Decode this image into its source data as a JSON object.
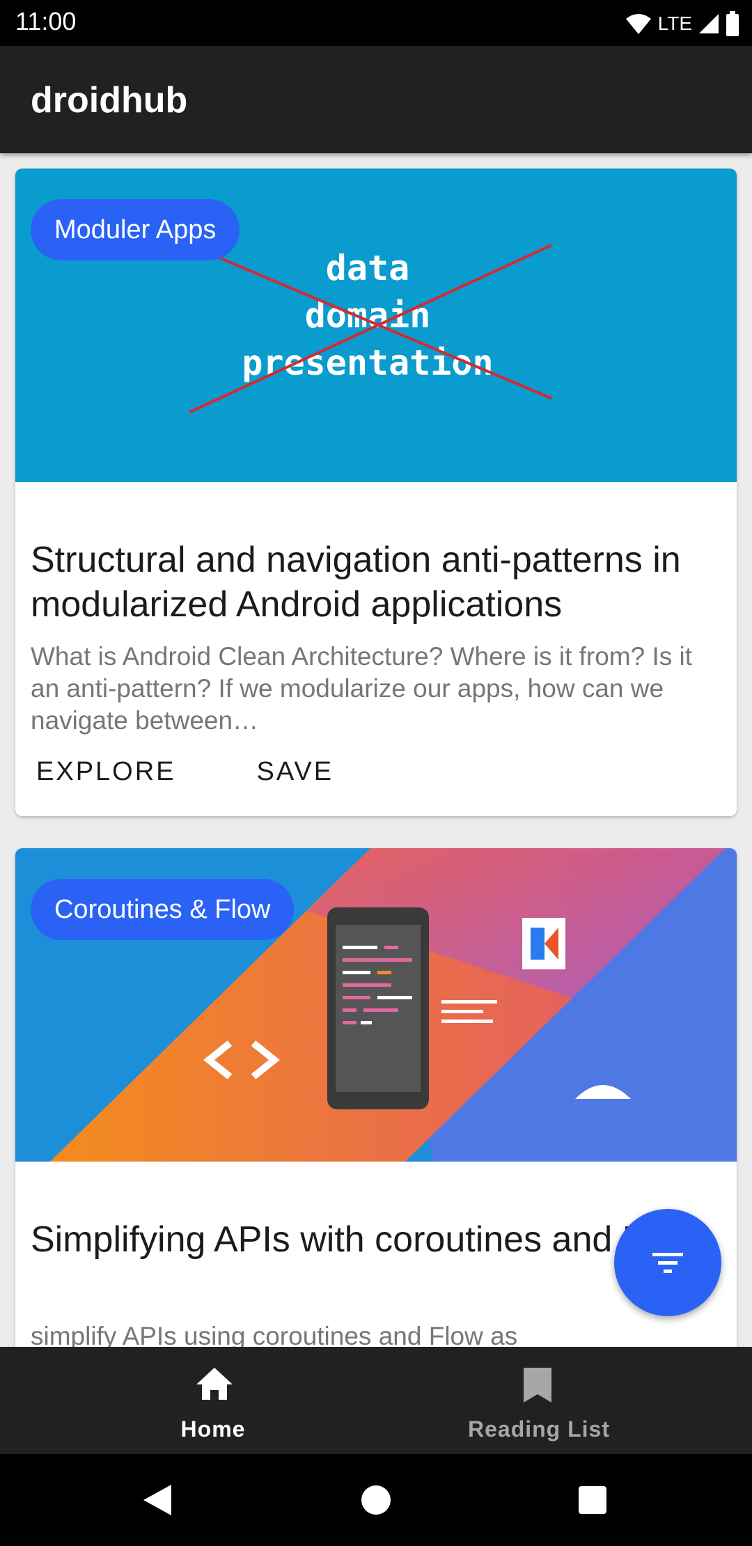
{
  "status_bar": {
    "time": "11:00",
    "network": "LTE"
  },
  "app_bar": {
    "title": "droidhub"
  },
  "cards": [
    {
      "chip": "Moduler Apps",
      "banner_words": [
        "data",
        "domain",
        "presentation"
      ],
      "title": "Structural and navigation anti-patterns in modularized Android applications",
      "description": "What is Android Clean Architecture? Where is it from? Is it an anti-pattern? If we modularize our apps, how can we navigate between…",
      "actions": [
        "EXPLORE",
        "SAVE"
      ]
    },
    {
      "chip": "Coroutines & Flow",
      "title": "Simplifying APIs with coroutines and Flow",
      "description": "simplify APIs using coroutines and Flow as"
    }
  ],
  "bottom_nav": {
    "items": [
      {
        "label": "Home",
        "icon": "home-icon"
      },
      {
        "label": "Reading List",
        "icon": "bookmark-icon"
      }
    ]
  },
  "colors": {
    "accent": "#2a62f6",
    "banner1": "#0a9bcf",
    "app_bar": "#212121"
  }
}
